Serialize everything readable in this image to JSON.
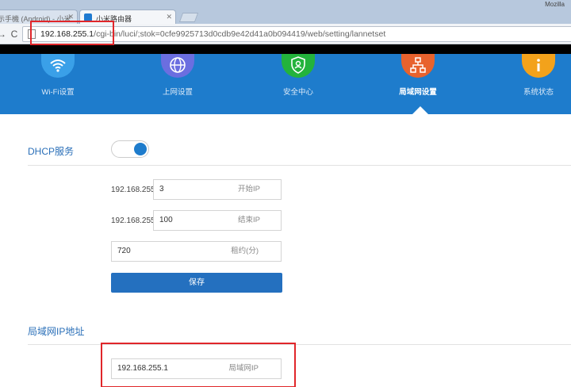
{
  "browser": {
    "tabs": [
      {
        "label": "示手機 (Android) - 小米...",
        "active": false
      },
      {
        "label": "小米路由器",
        "active": true
      }
    ],
    "window_label": "Mozilla",
    "url_host": "192.168.255.1",
    "url_path": "/cgi-bin/luci/;stok=0cfe9925713d0cdb9e42d41a0b094419/web/setting/lannetset"
  },
  "nav": {
    "items": [
      {
        "label": "Wi-Fi设置",
        "icon": "wifi-icon",
        "color": "#3aa0e8"
      },
      {
        "label": "上网设置",
        "icon": "globe-icon",
        "color": "#6b6ee0"
      },
      {
        "label": "安全中心",
        "icon": "shield-user-icon",
        "color": "#23b33c"
      },
      {
        "label": "局域网设置",
        "icon": "network-icon",
        "color": "#e8622d",
        "active": true
      },
      {
        "label": "系统状态",
        "icon": "info-icon",
        "color": "#f3a21b"
      }
    ]
  },
  "dhcp": {
    "title": "DHCP服务",
    "enabled": true,
    "ip_prefix": "192.168.255",
    "start_value": "3",
    "start_label": "开始IP",
    "end_value": "100",
    "end_label": "结束IP",
    "lease_value": "720",
    "lease_label": "租约(分)",
    "save_label": "保存"
  },
  "lan": {
    "title": "局域网IP地址",
    "ip_value": "192.168.255.1",
    "ip_label": "局域网IP"
  },
  "colors": {
    "header_blue": "#1e7ccc",
    "accent": "#2470bf",
    "annotation_red": "#e0262a"
  }
}
